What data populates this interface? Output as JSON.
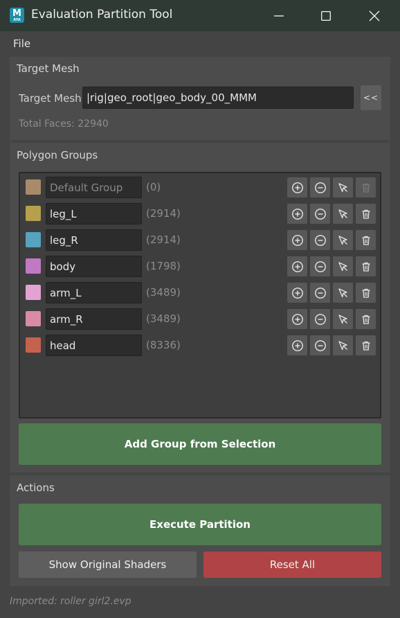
{
  "window": {
    "title": "Evaluation Partition Tool",
    "app_icon_letter": "M",
    "app_icon_sub": "AYA"
  },
  "menu": {
    "file": "File"
  },
  "target_mesh_section": {
    "title": "Target Mesh",
    "label": "Target Mesh:",
    "value": "|rig|geo_root|geo_body_00_MMM",
    "pick_button": "<<",
    "total_faces": "Total Faces: 22940"
  },
  "polygon_groups": {
    "title": "Polygon Groups",
    "groups": [
      {
        "name": "Default Group",
        "count": "(0)",
        "color": "#a88b6b"
      },
      {
        "name": "leg_L",
        "count": "(2914)",
        "color": "#b5a04e"
      },
      {
        "name": "leg_R",
        "count": "(2914)",
        "color": "#56a3c0"
      },
      {
        "name": "body",
        "count": "(1798)",
        "color": "#c279c3"
      },
      {
        "name": "arm_L",
        "count": "(3489)",
        "color": "#e3a2d2"
      },
      {
        "name": "arm_R",
        "count": "(3489)",
        "color": "#d98aa6"
      },
      {
        "name": "head",
        "count": "(8336)",
        "color": "#c5624f"
      }
    ],
    "add_button": "Add Group from Selection"
  },
  "actions": {
    "title": "Actions",
    "execute_button": "Execute Partition",
    "show_shaders_button": "Show Original Shaders",
    "reset_button": "Reset All"
  },
  "colors": {
    "accent_green": "#4f7b50",
    "reset_red": "#b04345",
    "title_bar": "#2e3a33"
  },
  "icons": {
    "add": "plus-circle-icon",
    "remove": "minus-circle-icon",
    "select": "cursor-arrow-icon",
    "delete": "trash-icon"
  },
  "status": "Imported: roller girl2.evp"
}
